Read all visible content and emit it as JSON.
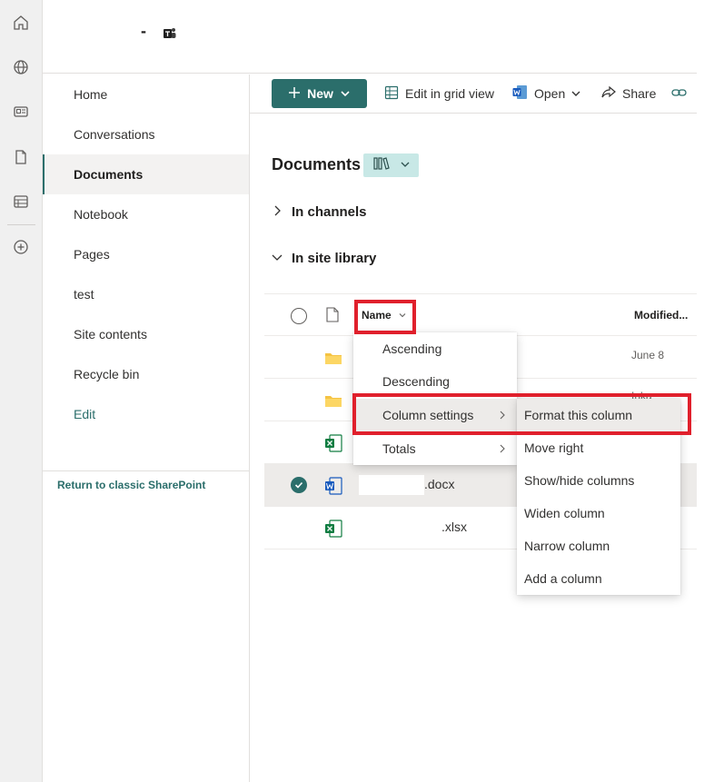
{
  "rail": {
    "icons": [
      "home-icon",
      "globe-icon",
      "news-icon",
      "document-icon",
      "list-icon",
      "add-icon"
    ]
  },
  "header": {
    "separator": "-",
    "teams_icon": "teams-icon"
  },
  "leftnav": {
    "items": [
      {
        "label": "Home"
      },
      {
        "label": "Conversations"
      },
      {
        "label": "Documents"
      },
      {
        "label": "Notebook"
      },
      {
        "label": "Pages"
      },
      {
        "label": "test"
      },
      {
        "label": "Site contents"
      },
      {
        "label": "Recycle bin"
      },
      {
        "label": "Edit"
      }
    ],
    "selected_index": 2,
    "classic_link": "Return to classic SharePoint"
  },
  "cmdbar": {
    "new_label": "New",
    "grid_label": "Edit in grid view",
    "open_label": "Open",
    "share_label": "Share"
  },
  "library": {
    "title": "Documents",
    "sections": [
      "In channels",
      "In site library"
    ]
  },
  "table": {
    "columns": {
      "name": "Name",
      "modified": "Modified..."
    },
    "rows": [
      {
        "type": "folder",
        "name": "",
        "modified": "June 8"
      },
      {
        "type": "folder",
        "name": "",
        "modified": "Inka"
      },
      {
        "type": "excel",
        "name": "",
        "modified": ""
      },
      {
        "type": "word",
        "name": ".docx",
        "modified": "",
        "selected": true
      },
      {
        "type": "excel",
        "name": ".xlsx",
        "modified": ""
      }
    ]
  },
  "column_menu": {
    "items": [
      "Ascending",
      "Descending",
      "Column settings",
      "Totals"
    ]
  },
  "settings_submenu": {
    "items": [
      "Format this column",
      "Move right",
      "Show/hide columns",
      "Widen column",
      "Narrow column",
      "Add a column"
    ]
  },
  "colors": {
    "accent": "#2b6e6b",
    "highlight": "#e0202c"
  }
}
